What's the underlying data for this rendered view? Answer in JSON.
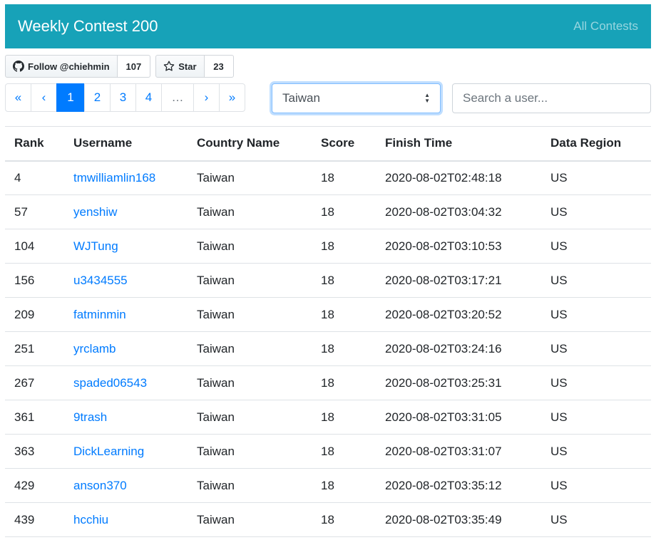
{
  "navbar": {
    "title": "Weekly Contest 200",
    "all_contests": "All Contests"
  },
  "github": {
    "follow_label": "Follow @chiehmin",
    "follow_count": "107",
    "star_label": "Star",
    "star_count": "23"
  },
  "pagination": {
    "first": "«",
    "prev": "‹",
    "pages": [
      "1",
      "2",
      "3",
      "4"
    ],
    "active_page": "1",
    "ellipsis": "…",
    "next": "›",
    "last": "»"
  },
  "filter": {
    "country": "Taiwan",
    "search_placeholder": "Search a user..."
  },
  "table": {
    "headers": [
      "Rank",
      "Username",
      "Country Name",
      "Score",
      "Finish Time",
      "Data Region"
    ],
    "rows": [
      {
        "rank": "4",
        "username": "tmwilliamlin168",
        "country": "Taiwan",
        "score": "18",
        "finish": "2020-08-02T02:48:18",
        "region": "US"
      },
      {
        "rank": "57",
        "username": "yenshiw",
        "country": "Taiwan",
        "score": "18",
        "finish": "2020-08-02T03:04:32",
        "region": "US"
      },
      {
        "rank": "104",
        "username": "WJTung",
        "country": "Taiwan",
        "score": "18",
        "finish": "2020-08-02T03:10:53",
        "region": "US"
      },
      {
        "rank": "156",
        "username": "u3434555",
        "country": "Taiwan",
        "score": "18",
        "finish": "2020-08-02T03:17:21",
        "region": "US"
      },
      {
        "rank": "209",
        "username": "fatminmin",
        "country": "Taiwan",
        "score": "18",
        "finish": "2020-08-02T03:20:52",
        "region": "US"
      },
      {
        "rank": "251",
        "username": "yrclamb",
        "country": "Taiwan",
        "score": "18",
        "finish": "2020-08-02T03:24:16",
        "region": "US"
      },
      {
        "rank": "267",
        "username": "spaded06543",
        "country": "Taiwan",
        "score": "18",
        "finish": "2020-08-02T03:25:31",
        "region": "US"
      },
      {
        "rank": "361",
        "username": "9trash",
        "country": "Taiwan",
        "score": "18",
        "finish": "2020-08-02T03:31:05",
        "region": "US"
      },
      {
        "rank": "363",
        "username": "DickLearning",
        "country": "Taiwan",
        "score": "18",
        "finish": "2020-08-02T03:31:07",
        "region": "US"
      },
      {
        "rank": "429",
        "username": "anson370",
        "country": "Taiwan",
        "score": "18",
        "finish": "2020-08-02T03:35:12",
        "region": "US"
      },
      {
        "rank": "439",
        "username": "hcchiu",
        "country": "Taiwan",
        "score": "18",
        "finish": "2020-08-02T03:35:49",
        "region": "US"
      }
    ]
  },
  "colors": {
    "navbar_bg": "#17a2b8",
    "link": "#007bff",
    "active_page_bg": "#007bff"
  }
}
